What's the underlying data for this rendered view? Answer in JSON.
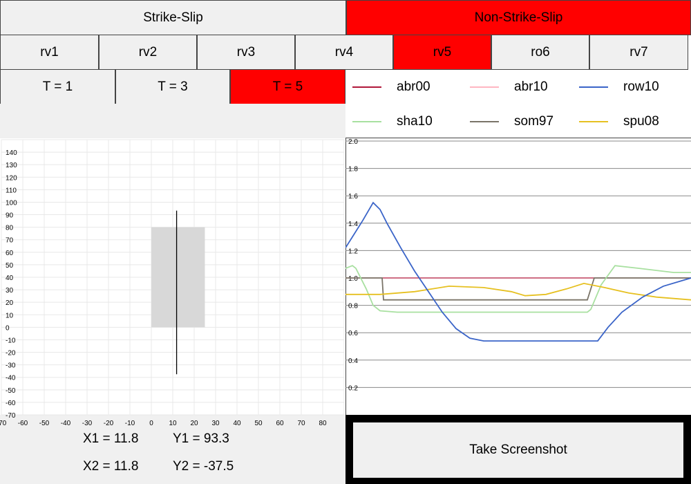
{
  "top_tabs": [
    {
      "label": "Strike-Slip",
      "active": false
    },
    {
      "label": "Non-Strike-Slip",
      "active": true
    }
  ],
  "model_tabs": [
    {
      "label": "rv1",
      "active": false
    },
    {
      "label": "rv2",
      "active": false
    },
    {
      "label": "rv3",
      "active": false
    },
    {
      "label": "rv4",
      "active": false
    },
    {
      "label": "rv5",
      "active": true
    },
    {
      "label": "ro6",
      "active": false
    },
    {
      "label": "rv7",
      "active": false
    }
  ],
  "period_tabs": [
    {
      "label": "T = 1",
      "active": false
    },
    {
      "label": "T = 3",
      "active": false
    },
    {
      "label": "T = 5",
      "active": true
    }
  ],
  "legend": [
    {
      "label": "abr00",
      "color": "#b0173a"
    },
    {
      "label": "abr10",
      "color": "#ffb6c1"
    },
    {
      "label": "row10",
      "color": "#3a64c8"
    },
    {
      "label": "sha10",
      "color": "#a8e0a0"
    },
    {
      "label": "som97",
      "color": "#7a7468"
    },
    {
      "label": "spu08",
      "color": "#e6c020"
    }
  ],
  "colors": {
    "active_tab": "#ff0000",
    "inactive_tab": "#f0f0f0",
    "grid": "#e8e8e8",
    "fault_rect": "#d8d8d8"
  },
  "fault_map": {
    "xlim": [
      -70,
      90
    ],
    "ylim": [
      -70,
      150
    ],
    "x_ticks": [
      -70,
      -60,
      -50,
      -40,
      -30,
      -20,
      -10,
      0,
      10,
      20,
      30,
      40,
      50,
      60,
      70,
      80
    ],
    "y_ticks": [
      -70,
      -60,
      -50,
      -40,
      -30,
      -20,
      -10,
      0,
      10,
      20,
      30,
      40,
      50,
      60,
      70,
      80,
      90,
      100,
      110,
      120,
      130,
      140
    ],
    "rupture_rect": {
      "x1": 0,
      "x2": 25,
      "y1": 0,
      "y2": 80
    },
    "site_line": {
      "x1": 11.8,
      "y1": 93.3,
      "x2": 11.8,
      "y2": -37.5
    }
  },
  "readouts": {
    "x1": "X1 = 11.8",
    "y1": "Y1 = 93.3",
    "x2": "X2 = 11.8",
    "y2": "Y2 = -37.5"
  },
  "screenshot_button": {
    "label": "Take Screenshot"
  },
  "chart_data": {
    "type": "line",
    "ylim": [
      0,
      2.0
    ],
    "y_ticks": [
      "0.2",
      "0.4",
      "0.6",
      "0.8",
      "1.0",
      "1.2",
      "1.4",
      "1.6",
      "1.8",
      "2.0"
    ],
    "y_tick_values": [
      0.2,
      0.4,
      0.6,
      0.8,
      1.0,
      1.2,
      1.4,
      1.6,
      1.8,
      2.0
    ],
    "xlim": [
      0,
      100
    ],
    "series": [
      {
        "name": "abr00",
        "color": "#b0173a",
        "points": [
          [
            0,
            1.0
          ],
          [
            100,
            1.0
          ]
        ]
      },
      {
        "name": "som97",
        "color": "#7a7468",
        "points": [
          [
            0,
            1.0
          ],
          [
            10.6,
            1.0
          ],
          [
            11,
            0.84
          ],
          [
            70,
            0.84
          ],
          [
            72,
            1.0
          ],
          [
            100,
            1.0
          ]
        ]
      },
      {
        "name": "sha10",
        "color": "#a8e0a0",
        "points": [
          [
            0,
            1.07
          ],
          [
            2,
            1.09
          ],
          [
            3,
            1.07
          ],
          [
            6,
            0.92
          ],
          [
            8,
            0.8
          ],
          [
            10,
            0.76
          ],
          [
            15,
            0.75
          ],
          [
            40,
            0.75
          ],
          [
            70,
            0.75
          ],
          [
            71,
            0.77
          ],
          [
            74,
            0.95
          ],
          [
            78,
            1.09
          ],
          [
            85,
            1.07
          ],
          [
            95,
            1.04
          ],
          [
            100,
            1.04
          ]
        ]
      },
      {
        "name": "spu08",
        "color": "#e6c020",
        "points": [
          [
            0,
            0.88
          ],
          [
            10,
            0.88
          ],
          [
            20,
            0.9
          ],
          [
            30,
            0.94
          ],
          [
            40,
            0.93
          ],
          [
            48,
            0.9
          ],
          [
            52,
            0.87
          ],
          [
            58,
            0.88
          ],
          [
            64,
            0.92
          ],
          [
            69,
            0.96
          ],
          [
            75,
            0.93
          ],
          [
            82,
            0.89
          ],
          [
            90,
            0.86
          ],
          [
            100,
            0.84
          ]
        ]
      },
      {
        "name": "row10",
        "color": "#3a64c8",
        "points": [
          [
            0,
            1.22
          ],
          [
            2,
            1.3
          ],
          [
            5,
            1.42
          ],
          [
            8,
            1.55
          ],
          [
            10,
            1.5
          ],
          [
            12,
            1.4
          ],
          [
            16,
            1.22
          ],
          [
            20,
            1.05
          ],
          [
            24,
            0.9
          ],
          [
            28,
            0.75
          ],
          [
            32,
            0.63
          ],
          [
            36,
            0.56
          ],
          [
            40,
            0.54
          ],
          [
            60,
            0.54
          ],
          [
            73,
            0.54
          ],
          [
            76,
            0.64
          ],
          [
            80,
            0.75
          ],
          [
            86,
            0.86
          ],
          [
            92,
            0.94
          ],
          [
            100,
            1.0
          ]
        ]
      }
    ]
  }
}
